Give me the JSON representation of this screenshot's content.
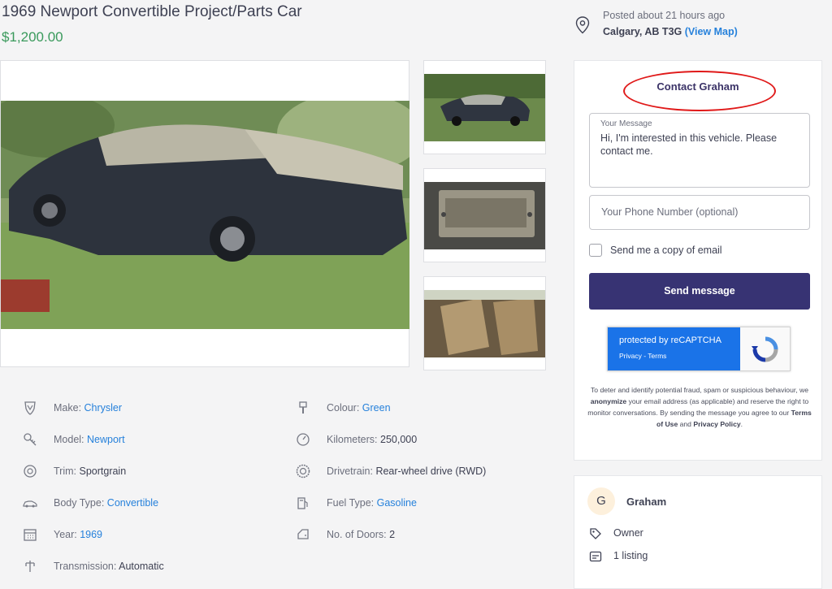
{
  "listing": {
    "title": "1969 Newport Convertible Project/Parts Car",
    "price": "$1,200.00"
  },
  "location": {
    "posted": "Posted about 21 hours ago",
    "city": "Calgary, AB T3G",
    "view_map": "(View Map)"
  },
  "specs": {
    "make": {
      "label": "Make: ",
      "value": "Chrysler"
    },
    "model": {
      "label": "Model: ",
      "value": "Newport"
    },
    "trim": {
      "label": "Trim: ",
      "value": "Sportgrain"
    },
    "body_type": {
      "label": "Body Type: ",
      "value": "Convertible"
    },
    "year": {
      "label": "Year: ",
      "value": "1969"
    },
    "transmission": {
      "label": "Transmission: ",
      "value": "Automatic"
    },
    "colour": {
      "label": "Colour: ",
      "value": "Green"
    },
    "kilometers": {
      "label": "Kilometers: ",
      "value": "250,000"
    },
    "drivetrain": {
      "label": "Drivetrain: ",
      "value": "Rear-wheel drive (RWD)"
    },
    "fuel_type": {
      "label": "Fuel Type: ",
      "value": "Gasoline"
    },
    "doors": {
      "label": "No. of Doors: ",
      "value": "2"
    }
  },
  "contact": {
    "title": "Contact Graham",
    "message_label": "Your Message",
    "message_value": "Hi, I'm interested in this vehicle. Please contact me.",
    "phone_placeholder": "Your Phone Number (optional)",
    "copy_label": "Send me a copy of email",
    "send_label": "Send message",
    "recaptcha_title": "protected by reCAPTCHA",
    "recaptcha_links": "Privacy - Terms",
    "disclaimer": {
      "part1": "To deter and identify potential fraud, spam or suspicious behaviour, we ",
      "bold1": "anonymize",
      "part2": " your email address (as applicable) and reserve the right to monitor conversations. By sending the message you agree to our ",
      "bold2": "Terms of Use",
      "part3": " and ",
      "bold3": "Privacy Policy",
      "part4": "."
    }
  },
  "seller": {
    "initial": "G",
    "name": "Graham",
    "type": "Owner",
    "listings": "1 listing"
  },
  "colors": {
    "accent": "#373373",
    "price": "#3a9a5c",
    "link": "#2681db",
    "annotation": "#e01919"
  }
}
